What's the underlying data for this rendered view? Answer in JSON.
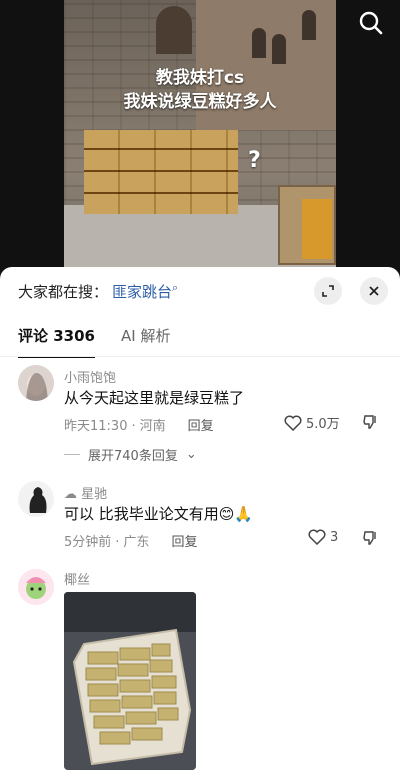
{
  "video": {
    "overlay_line1": "教我妹打cs",
    "overlay_line2": "我妹说绿豆糕好多人",
    "question_mark": "?"
  },
  "top_bar": {
    "search_icon": "search-icon"
  },
  "sheet": {
    "everyone_label": "大家都在搜：",
    "hot_search": "匪家跳台",
    "expand_icon": "expand-icon",
    "close_icon": "close-icon"
  },
  "tabs": [
    {
      "label": "评论 3306",
      "active": true
    },
    {
      "label": "AI 解析",
      "active": false
    }
  ],
  "comments": [
    {
      "name": "小雨饱饱",
      "text": "从今天起这里就是绿豆糕了",
      "time": "昨天11:30",
      "sep": "·",
      "location": "河南",
      "reply": "回复",
      "likes": "5.0万",
      "expand": "展开740条回复"
    },
    {
      "name_prefix": "☁",
      "name": "星驰",
      "text": "可以 比我毕业论文有用😊🙏",
      "time": "5分钟前",
      "sep": "·",
      "location": "广东",
      "reply": "回复",
      "likes": "3"
    },
    {
      "name": "椰丝"
    }
  ]
}
